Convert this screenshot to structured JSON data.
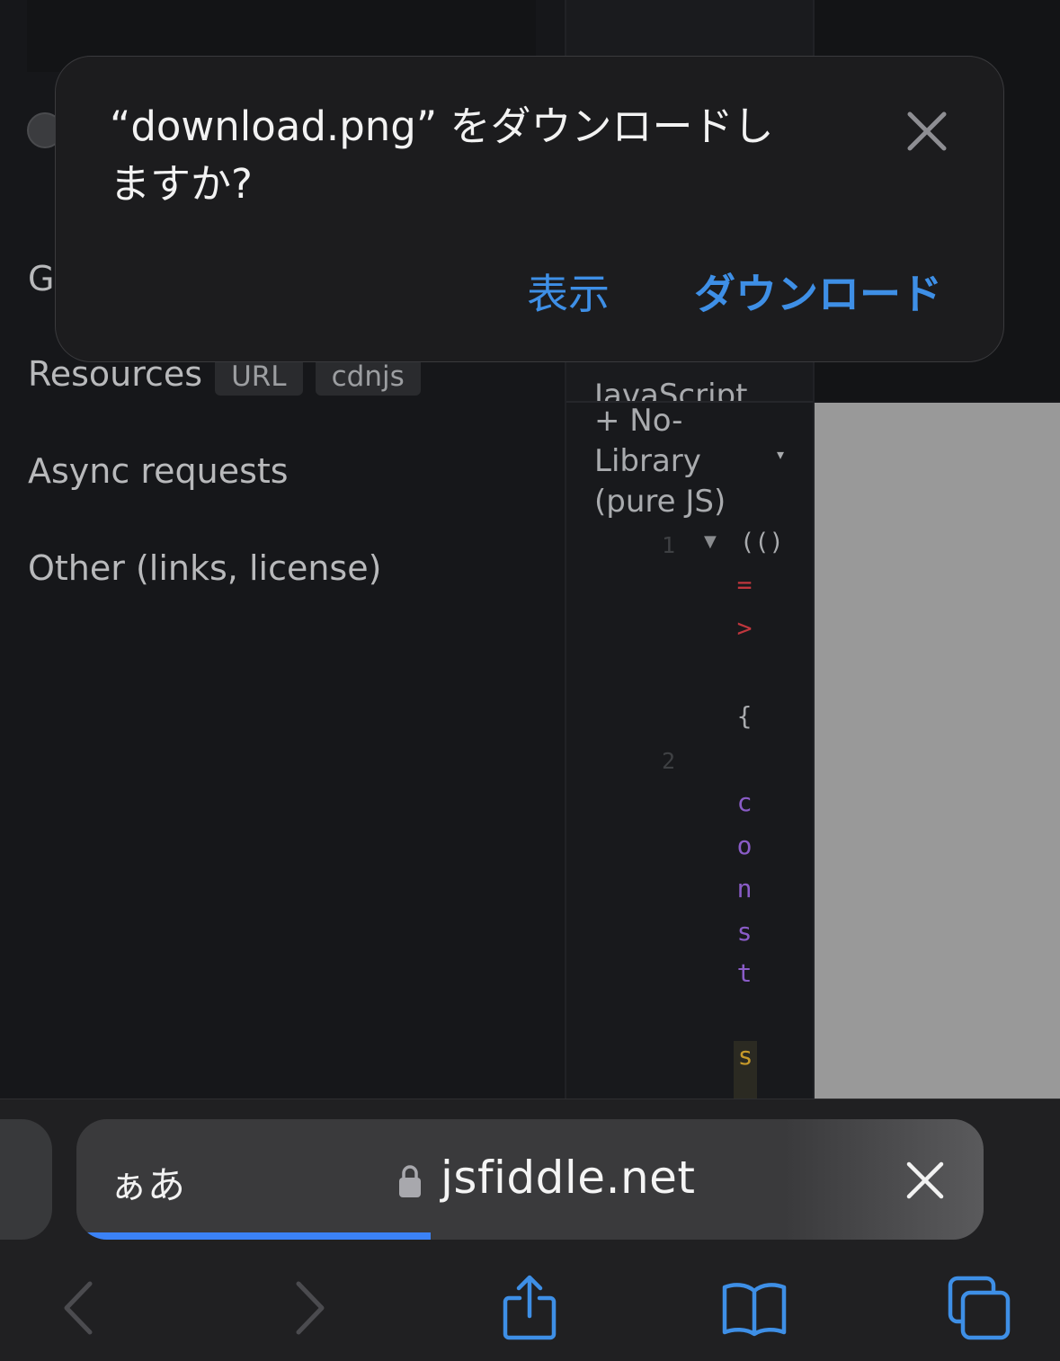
{
  "sidebar": {
    "partial_letter": "G",
    "items": [
      {
        "label": "Resources",
        "tags": [
          "URL",
          "cdnjs"
        ]
      },
      {
        "label": "Async requests"
      },
      {
        "label": "Other (links, license)"
      }
    ]
  },
  "js_panel": {
    "framework_label": "JavaScript + No-Library (pure JS)",
    "framework_line1": "JavaScript",
    "framework_line2": "+ No-",
    "framework_line3": "Library",
    "framework_line4": "(pure JS)",
    "line_numbers": [
      "1",
      "2"
    ],
    "code_line1": "(()",
    "code_chars": [
      "=",
      ">",
      "{",
      "c",
      "o",
      "n",
      "s",
      "t",
      "s"
    ]
  },
  "dialog": {
    "message_line1": "“download.png” をダウンロードし",
    "message_line2": "ますか?",
    "view_button": "表示",
    "download_button": "ダウンロード",
    "close_icon": "close-icon"
  },
  "address_bar": {
    "page_settings_label": "ぁあ",
    "url": "jsfiddle.net",
    "lock_icon": "lock-icon",
    "stop_icon": "close-icon",
    "load_progress": 0.39
  },
  "toolbar": {
    "icons": [
      "back-icon",
      "forward-icon",
      "share-icon",
      "bookmarks-icon",
      "tabs-icon"
    ]
  },
  "colors": {
    "accent": "#3e8fe6",
    "dialog_bg": "#1c1c1e",
    "progress": "#3b82f6",
    "code_keyword": "#8a5cc7",
    "code_operator": "#c0363d",
    "code_string": "#c79a2a"
  }
}
